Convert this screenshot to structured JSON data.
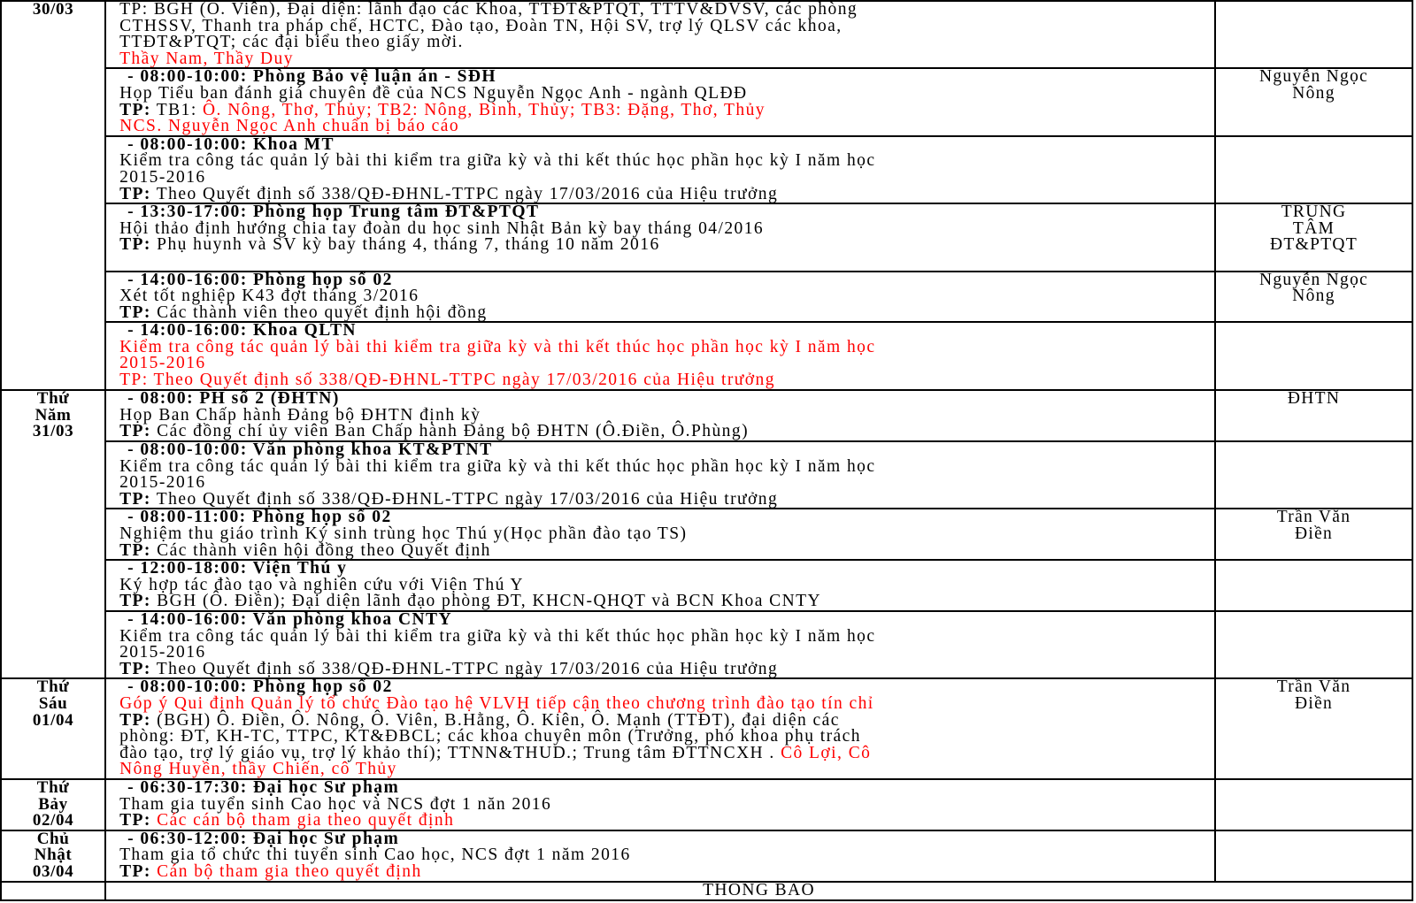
{
  "rows": [
    {
      "day": [
        "30/03"
      ],
      "lines": [
        {
          "segments": [
            {
              "text": "TP: BGH (Ô. Viên), Đại diện: lãnh đạo các Khoa, TTĐT&PTQT, TTTV&DVSV, các phòng",
              "color": "black"
            }
          ]
        },
        {
          "segments": [
            {
              "text": "CTHSSV, Thanh tra pháp chế, HCTC, Đào tạo, Đoàn TN, Hội SV, trợ lý QLSV các khoa,",
              "color": "black"
            }
          ]
        },
        {
          "segments": [
            {
              "text": "TTĐT&PTQT; các đại biểu theo giấy mời.",
              "color": "black"
            }
          ]
        },
        {
          "segments": [
            {
              "text": "Thầy Nam, Thầy Duy",
              "color": "red"
            }
          ]
        }
      ],
      "host": []
    },
    {
      "day": [],
      "lines": [
        {
          "heading": true,
          "segments": [
            {
              "text": "- 08:00-10:00: Phòng Bảo vệ luận án - SĐH",
              "color": "black",
              "bold": true
            }
          ]
        },
        {
          "segments": [
            {
              "text": "Họp Tiểu ban đánh giá chuyên đề của NCS Nguyễn Ngọc Anh - ngành QLĐĐ",
              "color": "black"
            }
          ]
        },
        {
          "segments": [
            {
              "text": "TP:",
              "color": "black",
              "bold": true
            },
            {
              "text": " TB1: ",
              "color": "black"
            },
            {
              "text": "Ô. Nông, Thơ, Thủy; TB2: Nông, Bình, Thủy; TB3: Đặng, Thơ, Thủy",
              "color": "red"
            }
          ]
        },
        {
          "segments": [
            {
              "text": "NCS. Nguyễn Ngọc Anh chuẩn bị báo cáo",
              "color": "red"
            }
          ]
        }
      ],
      "host": [
        "Nguyễn Ngọc",
        "Nông"
      ]
    },
    {
      "day": [],
      "lines": [
        {
          "heading": true,
          "segments": [
            {
              "text": "- 08:00-10:00: Khoa MT",
              "color": "black",
              "bold": true
            }
          ]
        },
        {
          "segments": [
            {
              "text": "Kiểm tra công tác quản lý bài thi kiểm tra giữa kỳ và thi kết thúc học phần học kỳ I năm học",
              "color": "black"
            }
          ]
        },
        {
          "segments": [
            {
              "text": "2015-2016",
              "color": "black"
            }
          ]
        },
        {
          "segments": [
            {
              "text": "TP:",
              "color": "black",
              "bold": true
            },
            {
              "text": " Theo Quyết định số 338/QĐ-ĐHNL-TTPC ngày 17/03/2016 của Hiệu trưởng",
              "color": "black"
            }
          ]
        }
      ],
      "host": []
    },
    {
      "day": [],
      "lines": [
        {
          "heading": true,
          "segments": [
            {
              "text": "- 13:30-17:00: Phòng họp Trung tâm ĐT&PTQT",
              "color": "black",
              "bold": true
            }
          ]
        },
        {
          "segments": [
            {
              "text": "Hội thảo định hướng chia tay đoàn du học sinh Nhật Bản kỳ bay tháng 04/2016",
              "color": "black"
            }
          ]
        },
        {
          "segments": [
            {
              "text": "TP:",
              "color": "black",
              "bold": true
            },
            {
              "text": " Phụ huynh và SV kỳ bay tháng 4, tháng 7, tháng 10 năm 2016",
              "color": "black"
            }
          ]
        },
        {
          "segments": [
            {
              "text": "",
              "color": "black"
            }
          ]
        }
      ],
      "host": [
        "TRUNG",
        "TÂM",
        "ĐT&PTQT"
      ]
    },
    {
      "day": [],
      "lines": [
        {
          "heading": true,
          "segments": [
            {
              "text": "- 14:00-16:00: Phòng họp số 02",
              "color": "black",
              "bold": true
            }
          ]
        },
        {
          "segments": [
            {
              "text": "Xét tốt nghiệp K43 đợt tháng 3/2016",
              "color": "black"
            }
          ]
        },
        {
          "segments": [
            {
              "text": "TP:",
              "color": "black",
              "bold": true
            },
            {
              "text": " Các thành viên theo quyết định hội đồng",
              "color": "black"
            }
          ]
        }
      ],
      "host": [
        "Nguyễn Ngọc",
        "Nông"
      ]
    },
    {
      "day": [],
      "lines": [
        {
          "heading": true,
          "segments": [
            {
              "text": "- 14:00-16:00: Khoa QLTN",
              "color": "black",
              "bold": true
            }
          ]
        },
        {
          "segments": [
            {
              "text": "Kiểm tra công tác quản lý bài thi kiểm tra giữa kỳ và thi kết thúc học phần học kỳ I năm học",
              "color": "red"
            }
          ]
        },
        {
          "segments": [
            {
              "text": "2015-2016",
              "color": "red"
            }
          ]
        },
        {
          "segments": [
            {
              "text": "TP: Theo Quyết định số 338/QĐ-ĐHNL-TTPC ngày 17/03/2016 của Hiệu trưởng",
              "color": "red"
            }
          ]
        }
      ],
      "host": []
    },
    {
      "day": [
        "Thứ",
        "Năm",
        "31/03"
      ],
      "rowspan": 5,
      "lines": [
        {
          "heading": true,
          "segments": [
            {
              "text": "- 08:00: PH số 2 (ĐHTN)",
              "color": "black",
              "bold": true
            }
          ]
        },
        {
          "segments": [
            {
              "text": "Họp Ban Chấp hành Đảng bộ ĐHTN định kỳ",
              "color": "black"
            }
          ]
        },
        {
          "segments": [
            {
              "text": "TP:",
              "color": "black",
              "bold": true
            },
            {
              "text": " Các đồng chí ủy viên Ban Chấp hành Đảng bộ ĐHTN (Ô.Điền, Ô.Phùng)",
              "color": "black"
            }
          ]
        }
      ],
      "host": [
        "ĐHTN"
      ]
    },
    {
      "day": [],
      "lines": [
        {
          "heading": true,
          "segments": [
            {
              "text": "- 08:00-10:00: Văn phòng khoa KT&PTNT",
              "color": "black",
              "bold": true
            }
          ]
        },
        {
          "segments": [
            {
              "text": "Kiểm tra công tác quản lý bài thi kiểm tra giữa kỳ và thi kết thúc học phần học kỳ I năm học",
              "color": "black"
            }
          ]
        },
        {
          "segments": [
            {
              "text": "2015-2016",
              "color": "black"
            }
          ]
        },
        {
          "segments": [
            {
              "text": "TP:",
              "color": "black",
              "bold": true
            },
            {
              "text": " Theo Quyết định số 338/QĐ-ĐHNL-TTPC ngày 17/03/2016 của Hiệu trưởng",
              "color": "black"
            }
          ]
        }
      ],
      "host": []
    },
    {
      "day": [],
      "lines": [
        {
          "heading": true,
          "segments": [
            {
              "text": "- 08:00-11:00: Phòng họp số 02",
              "color": "black",
              "bold": true
            }
          ]
        },
        {
          "segments": [
            {
              "text": "Nghiệm thu giáo trình Ký sinh trùng học Thú y(Học phần đào tạo TS)",
              "color": "black"
            }
          ]
        },
        {
          "segments": [
            {
              "text": "TP:",
              "color": "black",
              "bold": true
            },
            {
              "text": " Các thành viên hội đồng theo Quyết định",
              "color": "black"
            }
          ]
        }
      ],
      "host": [
        "Trần Văn",
        "Điền"
      ]
    },
    {
      "day": [],
      "lines": [
        {
          "heading": true,
          "segments": [
            {
              "text": "- 12:00-18:00: Viện Thú y",
              "color": "black",
              "bold": true
            }
          ]
        },
        {
          "segments": [
            {
              "text": "Ký hợp tác đào tạo và nghiên cứu với Viện Thú Y",
              "color": "black"
            }
          ]
        },
        {
          "segments": [
            {
              "text": "TP:",
              "color": "black",
              "bold": true
            },
            {
              "text": " BGH (Ô. Điền); Đại diện lãnh đạo phòng ĐT, KHCN-QHQT và BCN Khoa CNTY",
              "color": "black"
            }
          ]
        }
      ],
      "host": []
    },
    {
      "day": [],
      "lines": [
        {
          "heading": true,
          "segments": [
            {
              "text": "- 14:00-16:00: Văn phòng khoa CNTY",
              "color": "black",
              "bold": true
            }
          ]
        },
        {
          "segments": [
            {
              "text": "Kiểm tra công tác quản lý bài thi kiểm tra giữa kỳ và thi kết thúc học phần học kỳ I năm học",
              "color": "black"
            }
          ]
        },
        {
          "segments": [
            {
              "text": "2015-2016",
              "color": "black"
            }
          ]
        },
        {
          "segments": [
            {
              "text": "TP:",
              "color": "black",
              "bold": true
            },
            {
              "text": " Theo Quyết định số 338/QĐ-ĐHNL-TTPC ngày 17/03/2016 của Hiệu trưởng",
              "color": "black"
            }
          ]
        }
      ],
      "host": []
    },
    {
      "day": [
        "Thứ",
        "Sáu",
        "01/04"
      ],
      "lines": [
        {
          "heading": true,
          "segments": [
            {
              "text": "- 08:00-10:00: Phòng họp số 02",
              "color": "black",
              "bold": true
            }
          ]
        },
        {
          "segments": [
            {
              "text": "Góp ý Qui định Quản lý tổ chức Đào tạo hệ VLVH tiếp cận theo chương trình đào tạo tín chỉ",
              "color": "red"
            }
          ]
        },
        {
          "segments": [
            {
              "text": "TP:",
              "color": "black",
              "bold": true
            },
            {
              "text": " (BGH) Ô. Điền, Ô. Nông, Ô. Viên, B.Hằng, Ô. Kiên, Ô. Mạnh (TTĐT), đại diện các",
              "color": "black"
            }
          ]
        },
        {
          "segments": [
            {
              "text": "phòng: ĐT, KH-TC, TTPC, KT&ĐBCL; các khoa chuyên môn (Trưởng, phó khoa phụ trách",
              "color": "black"
            }
          ]
        },
        {
          "segments": [
            {
              "text": "đào tạo, trợ lý giáo vụ, trợ lý khảo thí); TTNN&THUD.; Trung tâm ĐTTNCXH . ",
              "color": "black"
            },
            {
              "text": "Cô Lợi, Cô",
              "color": "red"
            }
          ]
        },
        {
          "segments": [
            {
              "text": "Nông Huyền, thầy Chiến, cô Thủy",
              "color": "red"
            }
          ]
        }
      ],
      "host": [
        "Trần Văn",
        "Điền"
      ]
    },
    {
      "day": [
        "Thứ",
        "Bảy",
        "02/04"
      ],
      "lines": [
        {
          "heading": true,
          "segments": [
            {
              "text": "- 06:30-17:30: Đại học Sư phạm",
              "color": "black",
              "bold": true
            }
          ]
        },
        {
          "segments": [
            {
              "text": "Tham gia tuyển sinh Cao học và NCS đợt 1 năn 2016",
              "color": "black"
            }
          ]
        },
        {
          "segments": [
            {
              "text": "TP:",
              "color": "black",
              "bold": true
            },
            {
              "text": " Các cán bộ tham gia theo quyết định",
              "color": "red"
            }
          ]
        }
      ],
      "host": []
    },
    {
      "day": [
        "Chủ",
        "Nhật",
        "03/04"
      ],
      "lines": [
        {
          "heading": true,
          "segments": [
            {
              "text": "- 06:30-12:00: Đại học Sư phạm",
              "color": "black",
              "bold": true
            }
          ]
        },
        {
          "segments": [
            {
              "text": "Tham gia tổ chức thi tuyển sinh Cao học, NCS đợt 1 năm 2016",
              "color": "black"
            }
          ]
        },
        {
          "segments": [
            {
              "text": "TP:",
              "color": "black",
              "bold": true
            },
            {
              "text": " Cán bộ tham gia theo quyết định",
              "color": "red"
            }
          ]
        }
      ],
      "host": []
    }
  ],
  "notice": "THÔNG BÁO",
  "colors": {
    "red": "#ff0000",
    "black": "#000000",
    "border": "#000000"
  }
}
